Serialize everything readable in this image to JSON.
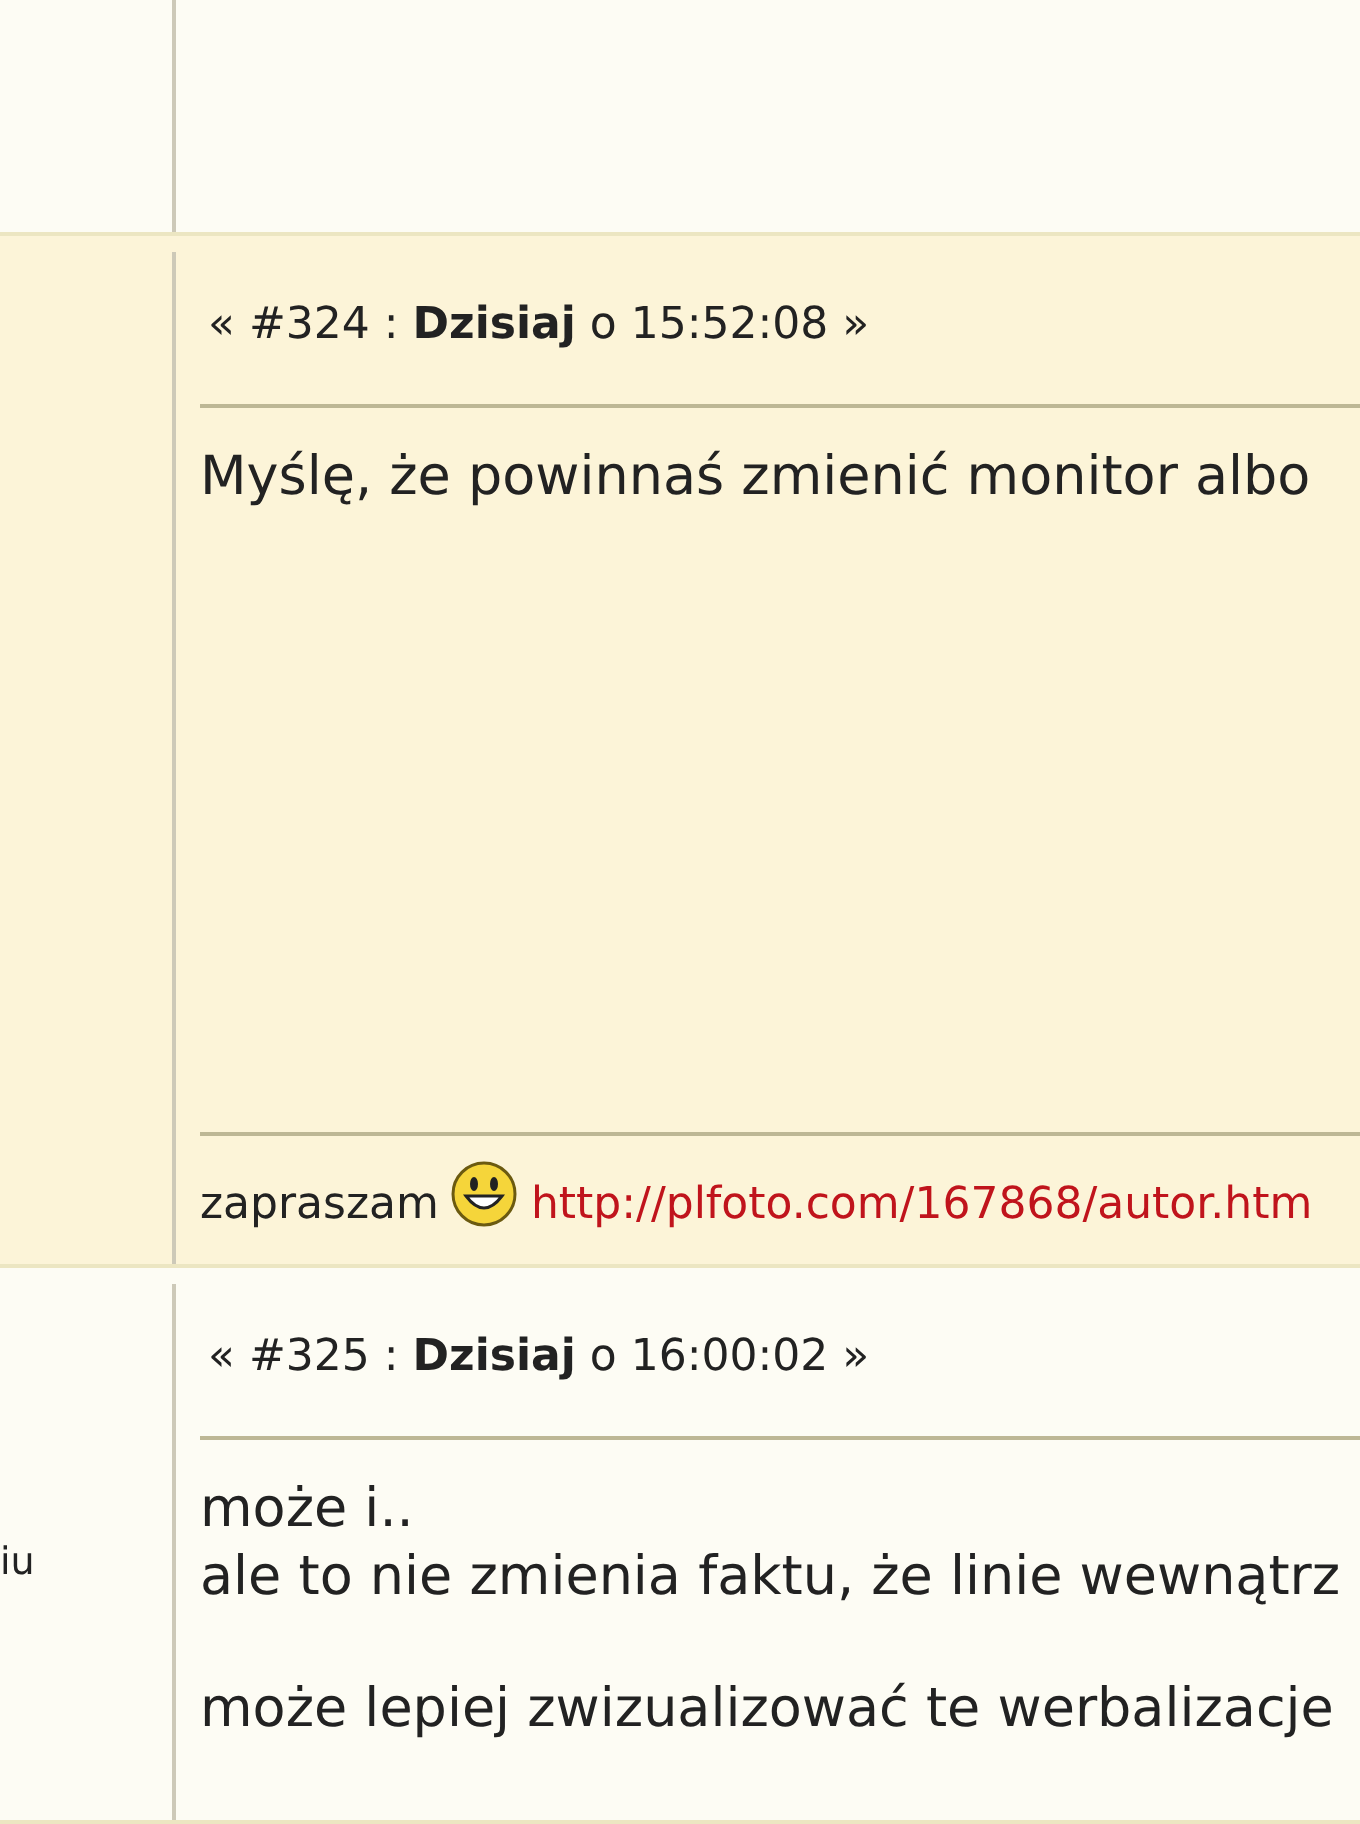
{
  "posts": [
    {
      "highlighted": true,
      "header": "« #324 : **Dzisiaj** o 15:52:08 »",
      "paragraphs": [
        [
          "Myślę, że powinnaś zmienić monitor albo"
        ]
      ],
      "signature": {
        "text": "zapraszam",
        "emoticon": true,
        "link": "http://plfoto.com/167868/autor.htm"
      }
    },
    {
      "highlighted": false,
      "author_text": "iu",
      "header": "« #325 : **Dzisiaj** o 16:00:02 »",
      "paragraphs": [
        [
          "może i..",
          "ale to nie zmienia faktu, że linie wewnątrz"
        ],
        [
          "może lepiej zwizualizować te werbalizacje"
        ]
      ]
    }
  ]
}
